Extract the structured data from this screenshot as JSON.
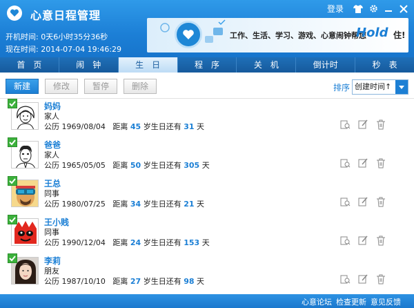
{
  "app": {
    "title": "心意日程管理",
    "uptime": "开机时间: 0天6小时35分36秒",
    "now": "现在时间: 2014-07-04 19:46:29",
    "login": "登录"
  },
  "banner": {
    "slogan": "工作、生活、学习、游戏、心意闹钟帮您",
    "brand": "Hold",
    "suffix": "住!"
  },
  "tabs": [
    "首　页",
    "闹　钟",
    "生　日",
    "程　序",
    "关　机",
    "倒计时",
    "秒　表"
  ],
  "toolbar": {
    "new": "新建",
    "edit": "修改",
    "pause": "暂停",
    "delete": "删除",
    "sort_label": "排序",
    "sort_value": "创建时间↑"
  },
  "labels": {
    "calendar": "公历",
    "distance": "距离",
    "years_birthday": "岁生日还有",
    "days": "天"
  },
  "contacts": [
    {
      "name": "妈妈",
      "relation": "家人",
      "date": "1969/08/04",
      "age": "45",
      "days": "31"
    },
    {
      "name": "爸爸",
      "relation": "家人",
      "date": "1965/05/05",
      "age": "50",
      "days": "305"
    },
    {
      "name": "王总",
      "relation": "同事",
      "date": "1980/07/25",
      "age": "34",
      "days": "21"
    },
    {
      "name": "王小贱",
      "relation": "同事",
      "date": "1990/12/04",
      "age": "24",
      "days": "153"
    },
    {
      "name": "李莉",
      "relation": "朋友",
      "date": "1987/10/10",
      "age": "27",
      "days": "98"
    }
  ],
  "footer": {
    "forum": "心意论坛",
    "update": "检查更新",
    "feedback": "意见反馈"
  },
  "colors": {
    "accent": "#1b7fd5",
    "check": "#3cb13c"
  }
}
